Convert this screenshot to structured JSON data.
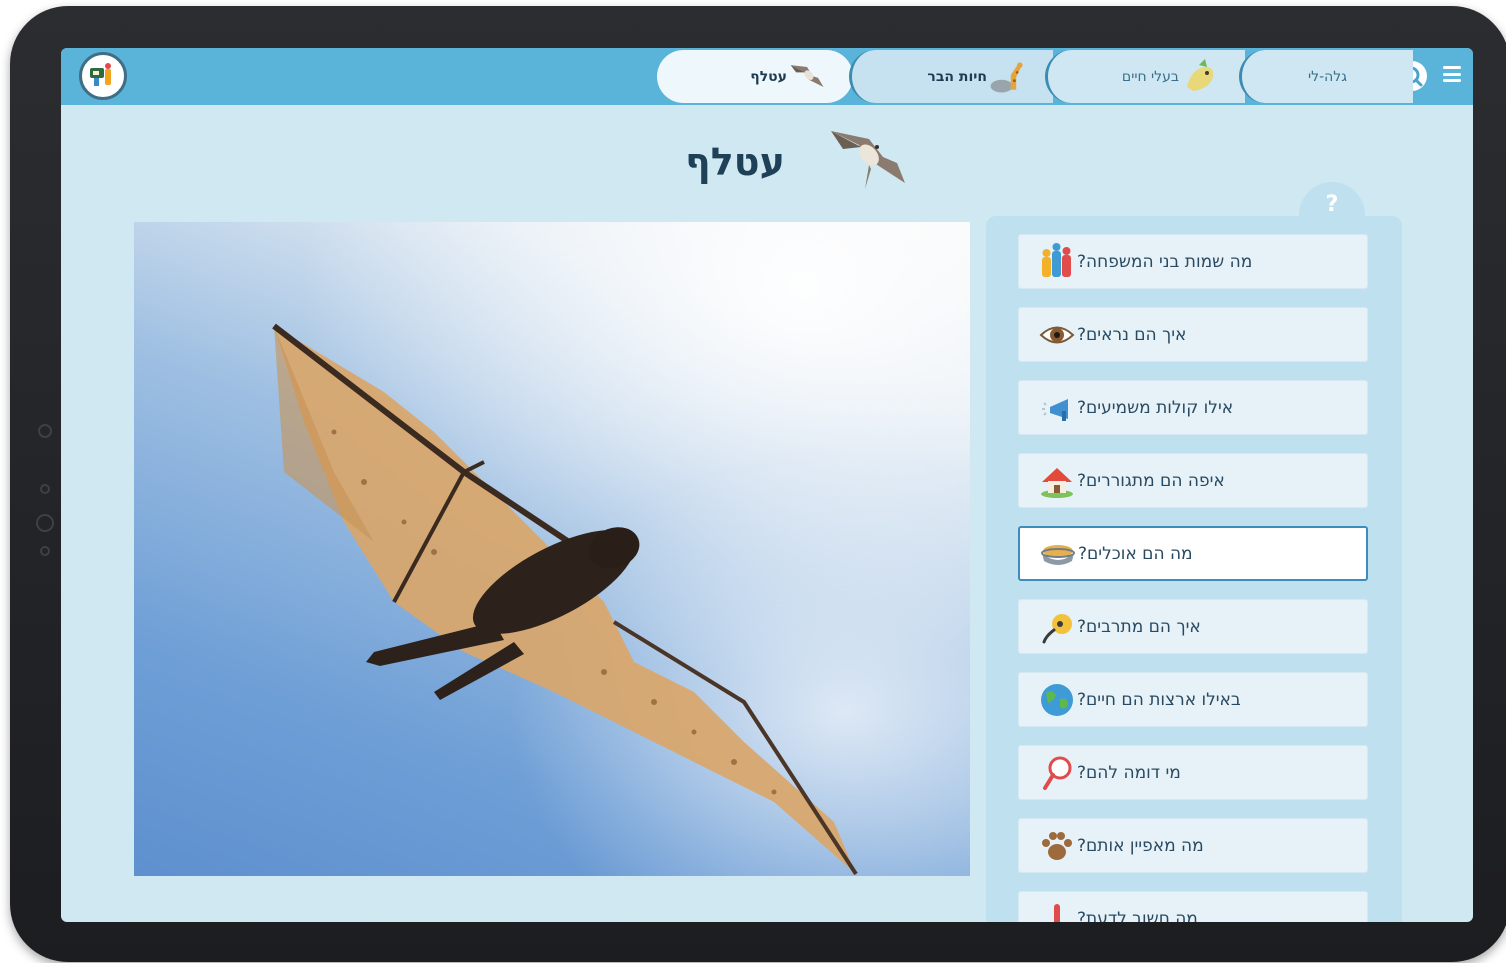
{
  "header": {
    "tabs": [
      {
        "label": "גלה-לי",
        "icon": "search-icon"
      },
      {
        "label": "בעלי חיים",
        "icon": "animals-icon"
      },
      {
        "label": "חיות הבר",
        "icon": "giraffe-icon"
      },
      {
        "label": "עטלף",
        "icon": "bat-icon"
      }
    ]
  },
  "page": {
    "title": "עטלף",
    "help_symbol": "?"
  },
  "questions": [
    {
      "label": "מה שמות בני המשפחה?",
      "icon": "family-icon"
    },
    {
      "label": "איך הם נראים?",
      "icon": "eye-icon"
    },
    {
      "label": "אילו קולות משמיעים?",
      "icon": "sound-icon"
    },
    {
      "label": "איפה הם מתגוררים?",
      "icon": "house-icon"
    },
    {
      "label": "מה הם אוכלים?",
      "icon": "food-bowl-icon",
      "active": true
    },
    {
      "label": "איך הם מתרבים?",
      "icon": "reproduction-icon"
    },
    {
      "label": "באילו ארצות הם חיים?",
      "icon": "globe-icon"
    },
    {
      "label": "מי דומה להם?",
      "icon": "magnifier-icon"
    },
    {
      "label": "מה מאפיין אותם?",
      "icon": "paw-icon"
    },
    {
      "label": "מה חשוב לדעת?",
      "icon": "exclamation-icon"
    }
  ],
  "colors": {
    "header_bar": "#5ab3d8",
    "screen_bg": "#d0e8f1",
    "active_border": "#3d8cbc",
    "title": "#1f4157"
  }
}
